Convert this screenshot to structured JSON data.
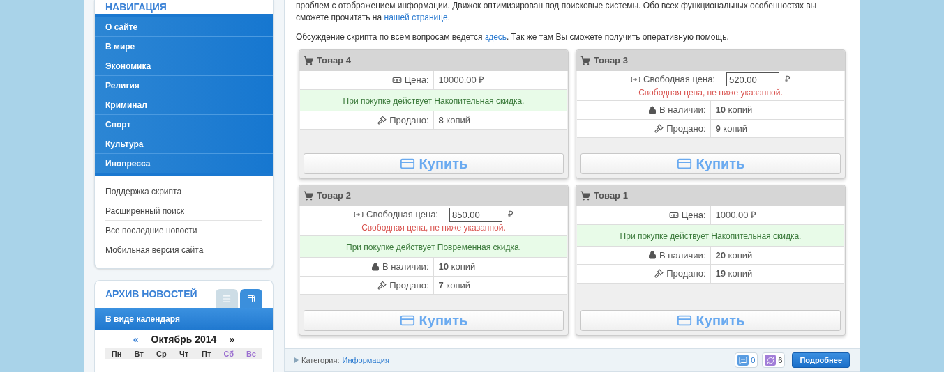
{
  "sidebar": {
    "nav_title": "НАВИГАЦИЯ",
    "nav_items": [
      "О сайте",
      "В мире",
      "Экономика",
      "Религия",
      "Криминал",
      "Спорт",
      "Культура",
      "Инопресса"
    ],
    "links": [
      "Поддержка скрипта",
      "Расширенный поиск",
      "Все последние новости",
      "Мобильная версия сайта"
    ],
    "archive": {
      "title": "АРХИВ НОВОСТЕЙ",
      "view_tabs": [
        {
          "kind": "list",
          "selected": false
        },
        {
          "kind": "grid",
          "selected": true
        }
      ],
      "mode": "В виде календаря",
      "prev": "«",
      "month": "Октябрь 2014",
      "next": "»",
      "weekdays": [
        {
          "label": "Пн",
          "weekend": false
        },
        {
          "label": "Вт",
          "weekend": false
        },
        {
          "label": "Ср",
          "weekend": false
        },
        {
          "label": "Чт",
          "weekend": false
        },
        {
          "label": "Пт",
          "weekend": false
        },
        {
          "label": "Сб",
          "weekend": true
        },
        {
          "label": "Вс",
          "weekend": true
        }
      ]
    }
  },
  "article": {
    "paragraphs": [
      [
        {
          "text": "проблем с отображением информации. Движок оптимизирован под поисковые системы. Обо всех функциональных особенностях вы сможете прочитать на ",
          "link": false
        },
        {
          "text": "нашей странице",
          "link": true
        },
        {
          "text": ".",
          "link": false
        }
      ],
      [
        {
          "text": "Обсуждение скрипта по всем вопросам ведется ",
          "link": false
        },
        {
          "text": "здесь",
          "link": true
        },
        {
          "text": ". Так же там Вы сможете получить оперативную помощь.",
          "link": false
        }
      ]
    ]
  },
  "products": [
    {
      "title": "Товар 4",
      "rows": [
        {
          "kind": "price",
          "label": "Цена:",
          "value": "10000.00 ₽"
        },
        {
          "kind": "discount",
          "text": "При покупке действует Накопительная скидка."
        },
        {
          "kind": "sold",
          "label": "Продано:",
          "value": "**8** копий"
        }
      ],
      "buy": "Купить"
    },
    {
      "title": "Товар 3",
      "rows": [
        {
          "kind": "free_price",
          "label": "Свободная цена:",
          "value": "520.00",
          "currency": "₽",
          "note": "Свободная цена, не ниже указанной."
        },
        {
          "kind": "stock",
          "label": "В наличии:",
          "value": "**10** копий"
        },
        {
          "kind": "sold",
          "label": "Продано:",
          "value": "**9** копий"
        }
      ],
      "buy": "Купить"
    },
    {
      "title": "Товар 2",
      "rows": [
        {
          "kind": "free_price",
          "label": "Свободная цена:",
          "value": "850.00",
          "currency": "₽",
          "note": "Свободная цена, не ниже указанной."
        },
        {
          "kind": "discount",
          "text": "При покупке действует Повременная скидка."
        },
        {
          "kind": "stock",
          "label": "В наличии:",
          "value": "**10** копий"
        },
        {
          "kind": "sold",
          "label": "Продано:",
          "value": "**7** копий"
        }
      ],
      "buy": "Купить"
    },
    {
      "title": "Товар 1",
      "rows": [
        {
          "kind": "price",
          "label": "Цена:",
          "value": "1000.00 ₽"
        },
        {
          "kind": "discount",
          "text": "При покупке действует Накопительная скидка."
        },
        {
          "kind": "stock",
          "label": "В наличии:",
          "value": "**20** копий"
        },
        {
          "kind": "sold",
          "label": "Продано:",
          "value": "**19** копий"
        }
      ],
      "buy": "Купить"
    }
  ],
  "footer": {
    "category_label": "Категория:",
    "category": "Информация",
    "comments": "0",
    "views": "6",
    "more": "Подробнее"
  }
}
